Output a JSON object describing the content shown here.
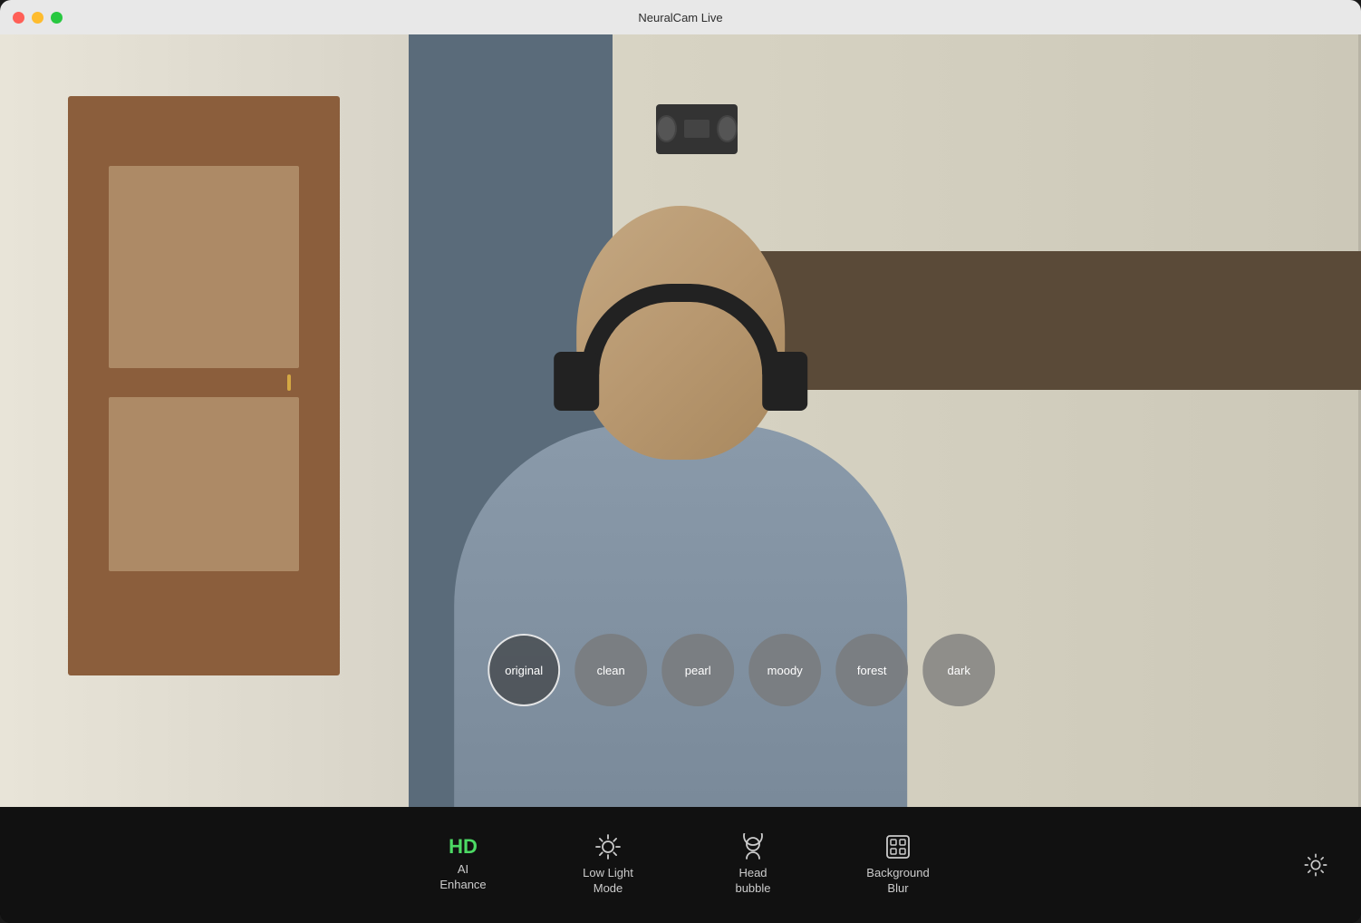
{
  "window": {
    "title": "NeuralCam Live"
  },
  "filters": [
    {
      "id": "original",
      "label": "original",
      "selected": true
    },
    {
      "id": "clean",
      "label": "clean",
      "selected": false
    },
    {
      "id": "pearl",
      "label": "pearl",
      "selected": false
    },
    {
      "id": "moody",
      "label": "moody",
      "selected": false
    },
    {
      "id": "forest",
      "label": "forest",
      "selected": false
    },
    {
      "id": "dark",
      "label": "dark",
      "selected": false
    }
  ],
  "toolbar": {
    "hd_label": "HD",
    "ai_enhance_label": "AI\nEnhance",
    "ai_enhance_line1": "AI",
    "ai_enhance_line2": "Enhance",
    "low_light_line1": "Low Light",
    "low_light_line2": "Mode",
    "head_bubble_line1": "Head",
    "head_bubble_line2": "bubble",
    "bg_blur_line1": "Background",
    "bg_blur_line2": "Blur"
  }
}
